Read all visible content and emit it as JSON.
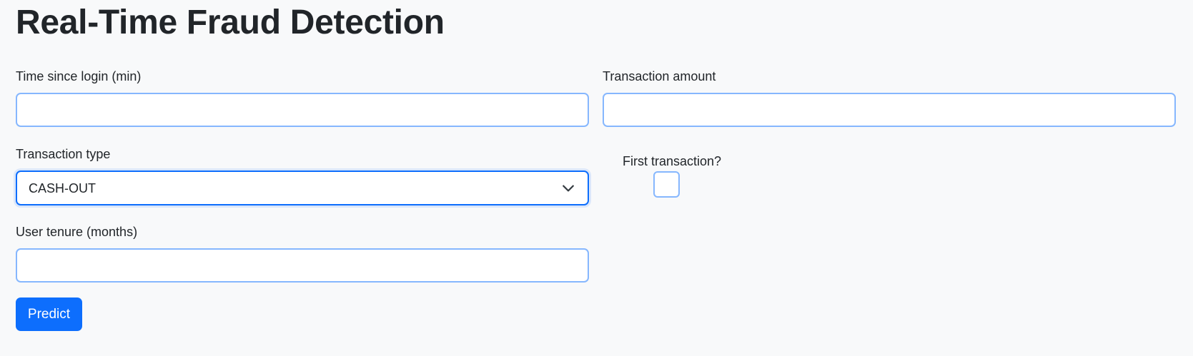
{
  "page": {
    "title": "Real-Time Fraud Detection"
  },
  "form": {
    "time_since_login": {
      "label": "Time since login (min)",
      "value": ""
    },
    "transaction_amount": {
      "label": "Transaction amount",
      "value": ""
    },
    "transaction_type": {
      "label": "Transaction type",
      "selected": "CASH-OUT"
    },
    "first_transaction": {
      "label": "First transaction?",
      "checked": false
    },
    "user_tenure": {
      "label": "User tenure (months)",
      "value": ""
    },
    "predict_button": "Predict"
  },
  "colors": {
    "background": "#f8f9fa",
    "input_border": "#86b7fe",
    "focus_border": "#0d6efd",
    "button": "#0d6efd",
    "text": "#212529"
  },
  "icons": {
    "select_arrow": "chevron-down-icon"
  }
}
